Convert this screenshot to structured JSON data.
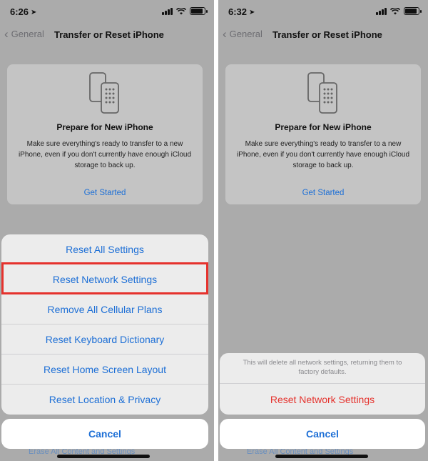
{
  "left": {
    "status": {
      "time": "6:26"
    },
    "nav": {
      "back_label": "General",
      "title": "Transfer or Reset iPhone"
    },
    "card": {
      "title": "Prepare for New iPhone",
      "body": "Make sure everything's ready to transfer to a new iPhone, even if you don't currently have enough iCloud storage to back up.",
      "link": "Get Started"
    },
    "sheet": {
      "items": [
        {
          "label": "Reset All Settings"
        },
        {
          "label": "Reset Network Settings",
          "highlighted": true
        },
        {
          "label": "Remove All Cellular Plans"
        },
        {
          "label": "Reset Keyboard Dictionary"
        },
        {
          "label": "Reset Home Screen Layout"
        },
        {
          "label": "Reset Location & Privacy"
        }
      ],
      "cancel_label": "Cancel"
    },
    "peek": "Erase All Content and Settings"
  },
  "right": {
    "status": {
      "time": "6:32"
    },
    "nav": {
      "back_label": "General",
      "title": "Transfer or Reset iPhone"
    },
    "card": {
      "title": "Prepare for New iPhone",
      "body": "Make sure everything's ready to transfer to a new iPhone, even if you don't currently have enough iCloud storage to back up.",
      "link": "Get Started"
    },
    "confirm": {
      "message": "This will delete all network settings, returning them to factory defaults.",
      "action_label": "Reset Network Settings",
      "cancel_label": "Cancel"
    },
    "peek": "Erase All Content and Settings"
  },
  "colors": {
    "accent_blue": "#1d6fd6",
    "destructive_red": "#e5322d",
    "highlight_red": "#e5322d",
    "dimmed_background": "#ababab"
  },
  "icons": [
    "location-arrow-icon",
    "signal-icon",
    "wifi-icon",
    "battery-icon",
    "chevron-left-icon",
    "two-phones-icon"
  ]
}
